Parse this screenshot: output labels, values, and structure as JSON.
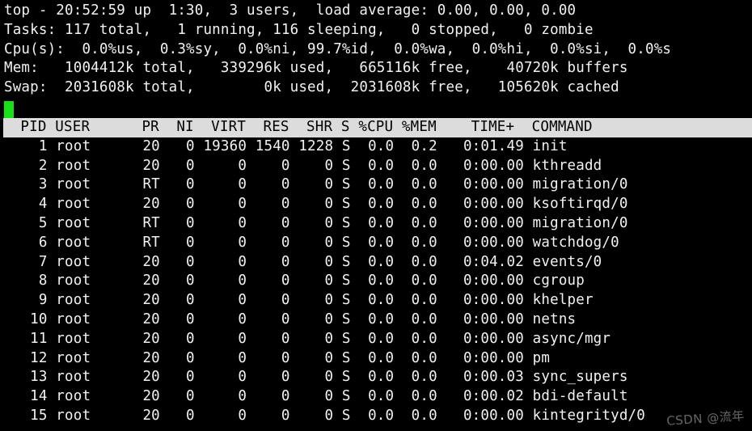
{
  "terminal": {
    "program": "top",
    "colors": {
      "background": "#000000",
      "foreground": "#f2f2f2",
      "header_bar_bg": "#dcdcdc",
      "header_bar_fg": "#000000",
      "cursor": "#15e215"
    }
  },
  "summary": {
    "uptime_line": "top - 20:52:59 up  1:30,  3 users,  load average: 0.00, 0.00, 0.00",
    "tasks_line": "Tasks: 117 total,   1 running, 116 sleeping,   0 stopped,   0 zombie",
    "cpu_line": "Cpu(s):  0.0%us,  0.3%sy,  0.0%ni, 99.7%id,  0.0%wa,  0.0%hi,  0.0%si,  0.0%s",
    "mem_line": "Mem:   1004412k total,   339296k used,   665116k free,    40720k buffers",
    "swap_line": "Swap:  2031608k total,        0k used,  2031608k free,   105620k cached",
    "fields": {
      "time": "20:52:59",
      "up": "1:30",
      "users": "3",
      "load_average": [
        "0.00",
        "0.00",
        "0.00"
      ],
      "tasks_total": "117",
      "tasks_running": "1",
      "tasks_sleeping": "116",
      "tasks_stopped": "0",
      "tasks_zombie": "0",
      "cpu_us": "0.0",
      "cpu_sy": "0.3",
      "cpu_ni": "0.0",
      "cpu_id": "99.7",
      "cpu_wa": "0.0",
      "cpu_hi": "0.0",
      "cpu_si": "0.0",
      "cpu_st": "0.0",
      "mem_total": "1004412k",
      "mem_used": "339296k",
      "mem_free": "665116k",
      "mem_buffers": "40720k",
      "swap_total": "2031608k",
      "swap_used": "0k",
      "swap_free": "2031608k",
      "swap_cached": "105620k"
    }
  },
  "cursor": {
    "glyph": "cursor-block"
  },
  "table": {
    "header_line": "  PID USER      PR  NI  VIRT  RES  SHR S %CPU %MEM    TIME+  COMMAND",
    "columns": [
      "PID",
      "USER",
      "PR",
      "NI",
      "VIRT",
      "RES",
      "SHR",
      "S",
      "%CPU",
      "%MEM",
      "TIME+",
      "COMMAND"
    ],
    "rows": [
      {
        "pid": "1",
        "user": "root",
        "pr": "20",
        "ni": "0",
        "virt": "19360",
        "res": "1540",
        "shr": "1228",
        "s": "S",
        "cpu": "0.0",
        "mem": "0.2",
        "time": "0:01.49",
        "command": "init"
      },
      {
        "pid": "2",
        "user": "root",
        "pr": "20",
        "ni": "0",
        "virt": "0",
        "res": "0",
        "shr": "0",
        "s": "S",
        "cpu": "0.0",
        "mem": "0.0",
        "time": "0:00.00",
        "command": "kthreadd"
      },
      {
        "pid": "3",
        "user": "root",
        "pr": "RT",
        "ni": "0",
        "virt": "0",
        "res": "0",
        "shr": "0",
        "s": "S",
        "cpu": "0.0",
        "mem": "0.0",
        "time": "0:00.00",
        "command": "migration/0"
      },
      {
        "pid": "4",
        "user": "root",
        "pr": "20",
        "ni": "0",
        "virt": "0",
        "res": "0",
        "shr": "0",
        "s": "S",
        "cpu": "0.0",
        "mem": "0.0",
        "time": "0:00.00",
        "command": "ksoftirqd/0"
      },
      {
        "pid": "5",
        "user": "root",
        "pr": "RT",
        "ni": "0",
        "virt": "0",
        "res": "0",
        "shr": "0",
        "s": "S",
        "cpu": "0.0",
        "mem": "0.0",
        "time": "0:00.00",
        "command": "migration/0"
      },
      {
        "pid": "6",
        "user": "root",
        "pr": "RT",
        "ni": "0",
        "virt": "0",
        "res": "0",
        "shr": "0",
        "s": "S",
        "cpu": "0.0",
        "mem": "0.0",
        "time": "0:00.00",
        "command": "watchdog/0"
      },
      {
        "pid": "7",
        "user": "root",
        "pr": "20",
        "ni": "0",
        "virt": "0",
        "res": "0",
        "shr": "0",
        "s": "S",
        "cpu": "0.0",
        "mem": "0.0",
        "time": "0:04.02",
        "command": "events/0"
      },
      {
        "pid": "8",
        "user": "root",
        "pr": "20",
        "ni": "0",
        "virt": "0",
        "res": "0",
        "shr": "0",
        "s": "S",
        "cpu": "0.0",
        "mem": "0.0",
        "time": "0:00.00",
        "command": "cgroup"
      },
      {
        "pid": "9",
        "user": "root",
        "pr": "20",
        "ni": "0",
        "virt": "0",
        "res": "0",
        "shr": "0",
        "s": "S",
        "cpu": "0.0",
        "mem": "0.0",
        "time": "0:00.00",
        "command": "khelper"
      },
      {
        "pid": "10",
        "user": "root",
        "pr": "20",
        "ni": "0",
        "virt": "0",
        "res": "0",
        "shr": "0",
        "s": "S",
        "cpu": "0.0",
        "mem": "0.0",
        "time": "0:00.00",
        "command": "netns"
      },
      {
        "pid": "11",
        "user": "root",
        "pr": "20",
        "ni": "0",
        "virt": "0",
        "res": "0",
        "shr": "0",
        "s": "S",
        "cpu": "0.0",
        "mem": "0.0",
        "time": "0:00.00",
        "command": "async/mgr"
      },
      {
        "pid": "12",
        "user": "root",
        "pr": "20",
        "ni": "0",
        "virt": "0",
        "res": "0",
        "shr": "0",
        "s": "S",
        "cpu": "0.0",
        "mem": "0.0",
        "time": "0:00.00",
        "command": "pm"
      },
      {
        "pid": "13",
        "user": "root",
        "pr": "20",
        "ni": "0",
        "virt": "0",
        "res": "0",
        "shr": "0",
        "s": "S",
        "cpu": "0.0",
        "mem": "0.0",
        "time": "0:00.03",
        "command": "sync_supers"
      },
      {
        "pid": "14",
        "user": "root",
        "pr": "20",
        "ni": "0",
        "virt": "0",
        "res": "0",
        "shr": "0",
        "s": "S",
        "cpu": "0.0",
        "mem": "0.0",
        "time": "0:00.02",
        "command": "bdi-default"
      },
      {
        "pid": "15",
        "user": "root",
        "pr": "20",
        "ni": "0",
        "virt": "0",
        "res": "0",
        "shr": "0",
        "s": "S",
        "cpu": "0.0",
        "mem": "0.0",
        "time": "0:00.00",
        "command": "kintegrityd/0"
      }
    ],
    "row_lines": [
      "    1 root      20   0 19360 1540 1228 S  0.0  0.2   0:01.49 init",
      "    2 root      20   0     0    0    0 S  0.0  0.0   0:00.00 kthreadd",
      "    3 root      RT   0     0    0    0 S  0.0  0.0   0:00.00 migration/0",
      "    4 root      20   0     0    0    0 S  0.0  0.0   0:00.00 ksoftirqd/0",
      "    5 root      RT   0     0    0    0 S  0.0  0.0   0:00.00 migration/0",
      "    6 root      RT   0     0    0    0 S  0.0  0.0   0:00.00 watchdog/0",
      "    7 root      20   0     0    0    0 S  0.0  0.0   0:04.02 events/0",
      "    8 root      20   0     0    0    0 S  0.0  0.0   0:00.00 cgroup",
      "    9 root      20   0     0    0    0 S  0.0  0.0   0:00.00 khelper",
      "   10 root      20   0     0    0    0 S  0.0  0.0   0:00.00 netns",
      "   11 root      20   0     0    0    0 S  0.0  0.0   0:00.00 async/mgr",
      "   12 root      20   0     0    0    0 S  0.0  0.0   0:00.00 pm",
      "   13 root      20   0     0    0    0 S  0.0  0.0   0:00.03 sync_supers",
      "   14 root      20   0     0    0    0 S  0.0  0.0   0:00.02 bdi-default",
      "   15 root      20   0     0    0    0 S  0.0  0.0   0:00.00 kintegrityd/0"
    ]
  },
  "watermark": {
    "text": "CSDN @流年"
  }
}
